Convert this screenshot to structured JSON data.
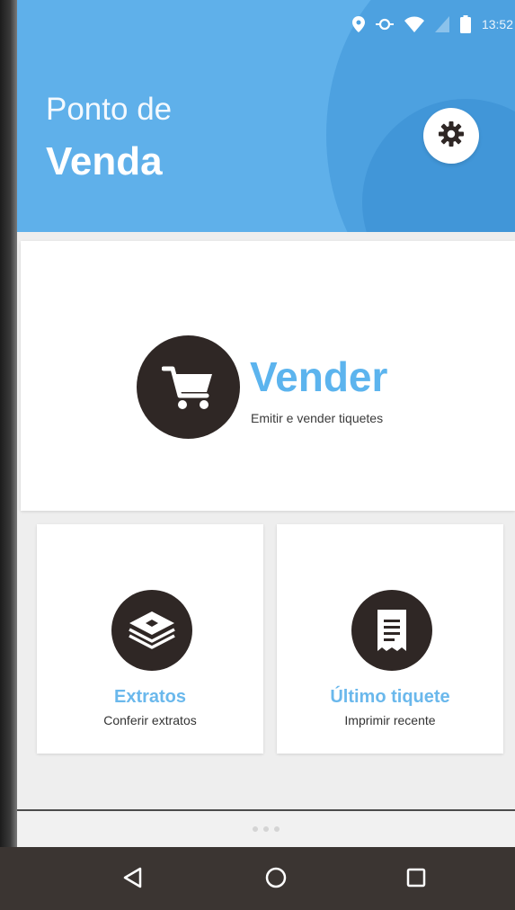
{
  "status_bar": {
    "time": "13:52",
    "icons": [
      "location-icon",
      "sync-icon",
      "wifi-icon",
      "signal-icon",
      "battery-icon"
    ]
  },
  "header": {
    "title_line1": "Ponto de",
    "title_line2": "Venda",
    "settings_icon": "gear-icon",
    "colors": {
      "primary": "#5fb0ea",
      "accent_text": "#5cb4ee"
    }
  },
  "sell_card": {
    "icon": "cart-icon",
    "title": "Vender",
    "subtitle": "Emitir e vender tiquetes"
  },
  "extratos_card": {
    "icon": "layers-icon",
    "title": "Extratos",
    "subtitle": "Conferir extratos"
  },
  "ultimo_card": {
    "icon": "receipt-icon",
    "title": "Último tiquete",
    "subtitle": "Imprimir recente"
  },
  "navbar": {
    "buttons": [
      "back-icon",
      "home-icon",
      "recent-apps-icon"
    ]
  }
}
